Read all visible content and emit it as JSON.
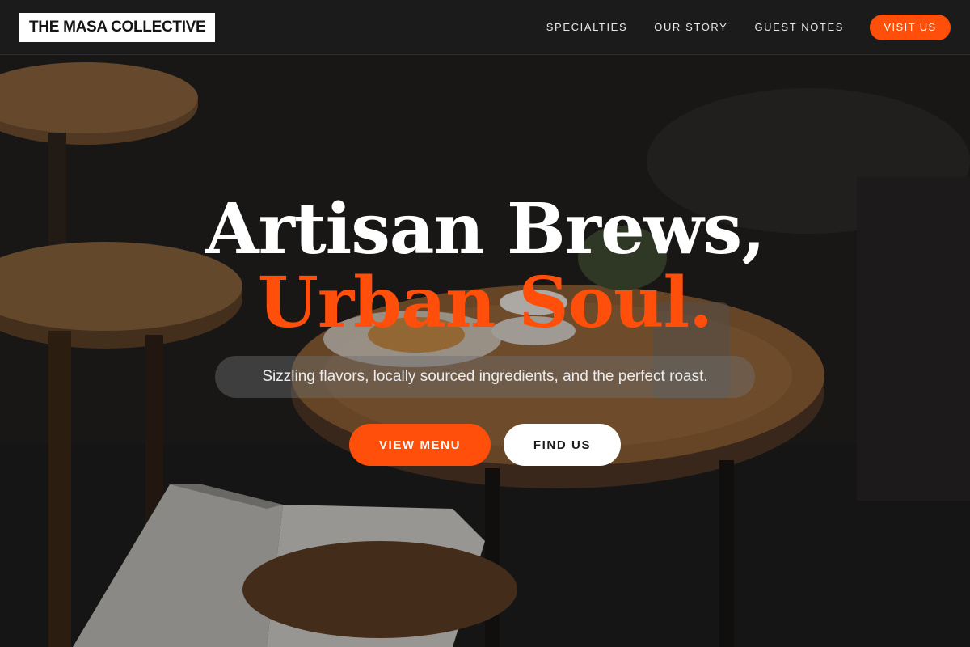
{
  "header": {
    "logo": "THE MASA COLLECTIVE",
    "nav": [
      {
        "label": "SPECIALTIES"
      },
      {
        "label": "OUR STORY"
      },
      {
        "label": "GUEST NOTES"
      }
    ],
    "cta": "VISIT US"
  },
  "hero": {
    "headline_line1": "Artisan Brews,",
    "headline_line2": "Urban Soul.",
    "subtitle": "Sizzling flavors, locally sourced ingredients, and the perfect roast.",
    "buttons": {
      "primary": "VIEW MENU",
      "secondary": "FIND US"
    },
    "background_image": "dark cafe interior with wooden stools, round table, coffee cup, pastry, plants and an open magazine"
  },
  "colors": {
    "accent": "#ff4f0a",
    "header_bg": "#1b1b1b",
    "text_light": "#ffffff"
  }
}
